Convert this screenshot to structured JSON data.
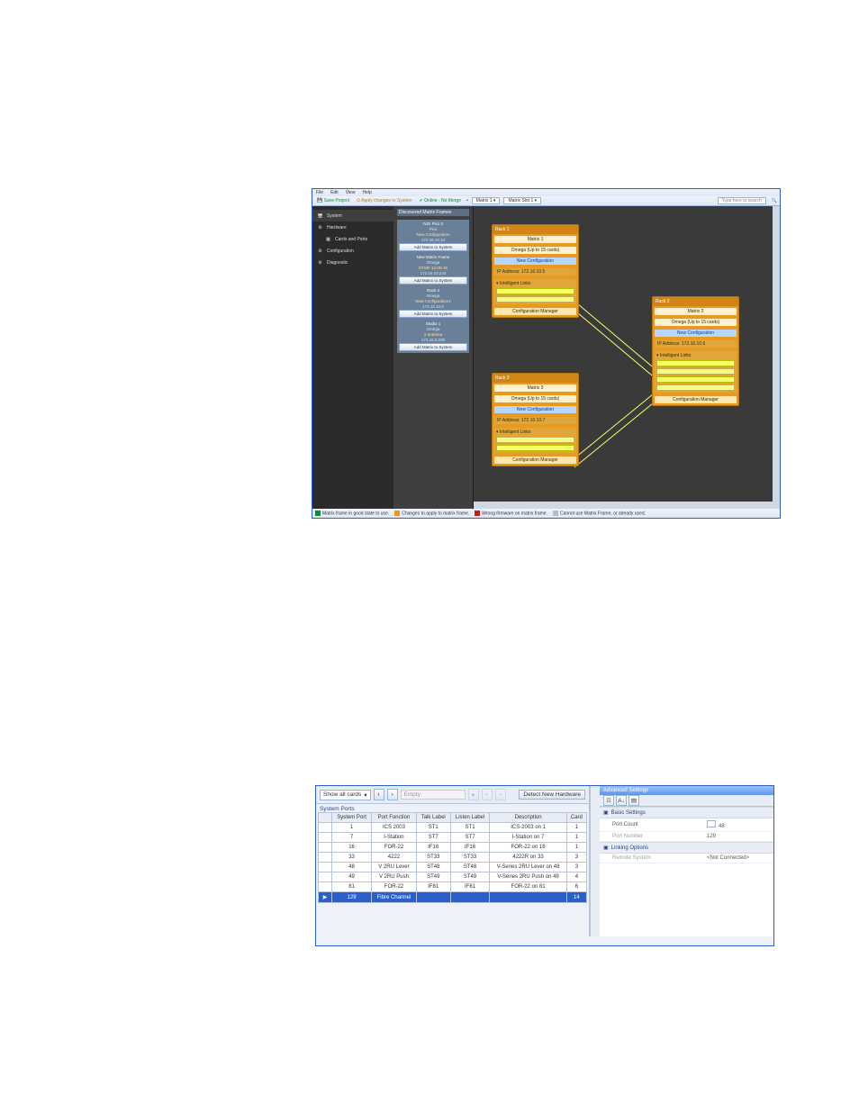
{
  "app1": {
    "menu": {
      "file": "File",
      "edit": "Edit",
      "view": "View",
      "help": "Help"
    },
    "toolbar": {
      "saveProject": "Save Project",
      "applyChanges": "Apply changes to System",
      "online": "Online - No Merge",
      "matrixDropdown": "Matrix 1",
      "slotDropdown": "Matrix Slot 1",
      "searchPlaceholder": "Type here to search"
    },
    "sidebar": {
      "system": "System",
      "hardware": "Hardware",
      "cardsPorts": "Cards and Ports",
      "configuration": "Configuration",
      "diagnostic": "Diagnostic"
    },
    "tree": {
      "title": "Discovered Matrix Frames",
      "frames": [
        {
          "title": "IVIE Pico 2",
          "line1": "Pico",
          "line2": "New Configuration",
          "ip": "172.16.10.10",
          "btn": "Add Matrix to System"
        },
        {
          "title": "New Matrix Frame",
          "line1": "Omega",
          "line2": "DTMF 12-09-15",
          "ip": "172.16.10.244",
          "btn": "Add Matrix to System"
        },
        {
          "title": "Rack 4",
          "line1": "Omega",
          "line2": "New Configuration1",
          "ip": "172.16.10.8",
          "btn": "Add Matrix to System"
        },
        {
          "title": "Studio 1",
          "line1": "Omega",
          "line2": "2 antenna",
          "ip": "172.16.9.236",
          "btn": "Add Matrix to System"
        }
      ]
    },
    "racks": {
      "r1": {
        "title": "Rack 1",
        "matrix": "Matrix 1",
        "type": "Omega (Up to 15 cards)",
        "cfg": "New Configuration",
        "ip": "IP Address: 172.16.10.5",
        "il": "Intelligent Links",
        "cfgmgr": "Configuration Manager"
      },
      "r2": {
        "title": "Rack 2",
        "matrix": "Matrix 2",
        "type": "Omega (Up to 15 cards)",
        "cfg": "New Configuration",
        "ip": "IP Address: 172.16.10.6",
        "il": "Intelligent Links",
        "cfgmgr": "Configuration Manager"
      },
      "r3": {
        "title": "Rack 3",
        "matrix": "Matrix 3",
        "type": "Omega (Up to 15 cards)",
        "cfg": "New Configuration",
        "ip": "IP Address: 172.16.10.7",
        "il": "Intelligent Links",
        "cfgmgr": "Configuration Manager"
      }
    },
    "status": {
      "good": "Matrix frame in good state to use.",
      "changes": "Changes to apply to matrix frame.",
      "wrong": "Wrong firmware on matrix frame.",
      "cannot": "Cannot use Matrix Frame, or already used."
    }
  },
  "app2": {
    "controls": {
      "showAll": "Show all cards",
      "empty": "Empty",
      "detect": "Detect New Hardware"
    },
    "tabs": {
      "systemPorts": "System Ports"
    },
    "columns": {
      "sysPort": "System Port",
      "portFn": "Port Function",
      "talk": "Talk Label",
      "listen": "Listen Label",
      "desc": "Description",
      "card": "Card"
    },
    "rows": [
      {
        "sysPort": "1",
        "portFn": "ICS 2003",
        "talk": "ST1",
        "listen": "ST1",
        "desc": "ICS-2003 on 1",
        "card": "1"
      },
      {
        "sysPort": "7",
        "portFn": "I-Station",
        "talk": "ST7",
        "listen": "ST7",
        "desc": "I-Station on 7",
        "card": "1"
      },
      {
        "sysPort": "16",
        "portFn": "FOR-22",
        "talk": "IF16",
        "listen": "IF16",
        "desc": "FOR-22 on 16",
        "card": "1"
      },
      {
        "sysPort": "33",
        "portFn": "4222",
        "talk": "ST33",
        "listen": "ST33",
        "desc": "4222R on 33",
        "card": "3"
      },
      {
        "sysPort": "48",
        "portFn": "V 2RU Lever",
        "talk": "ST48",
        "listen": "ST48",
        "desc": "V-Series 2RU Lever on 48",
        "card": "3"
      },
      {
        "sysPort": "49",
        "portFn": "V 2RU Push",
        "talk": "ST49",
        "listen": "ST49",
        "desc": "V-Series 2RU Push on 49",
        "card": "4"
      },
      {
        "sysPort": "81",
        "portFn": "FOR-22",
        "talk": "IF81",
        "listen": "IF81",
        "desc": "FOR-22 on 81",
        "card": "6"
      },
      {
        "sysPort": "129",
        "portFn": "Fibre Channel",
        "talk": "",
        "listen": "",
        "desc": "",
        "card": "14"
      }
    ],
    "right": {
      "title": "Advanced Settings",
      "groupBasic": "Basic Settings",
      "portCount": "Port Count",
      "portCountVal": "48",
      "portNumber": "Port Number",
      "portNumberVal": "129",
      "groupLinking": "Linking Options",
      "remoteSystem": "Remote System",
      "remoteSystemVal": "<Not Connected>"
    }
  }
}
